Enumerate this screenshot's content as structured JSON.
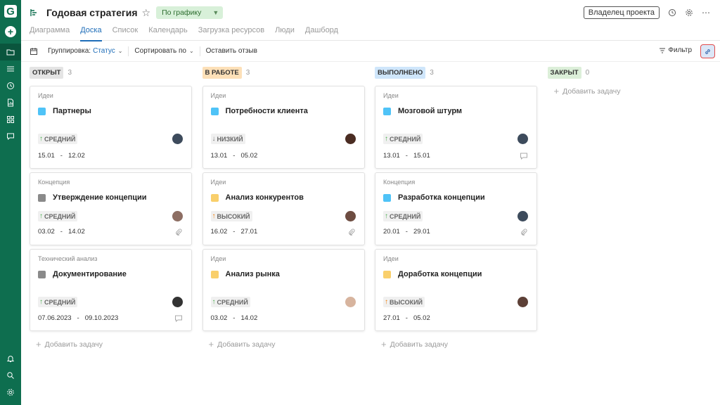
{
  "app": {
    "logo_letter": "G",
    "plus": "+"
  },
  "header": {
    "title": "Годовая стратегия",
    "status": "По графику",
    "owner_button": "Владелец проекта"
  },
  "tabs": [
    {
      "label": "Диаграмма",
      "active": false
    },
    {
      "label": "Доска",
      "active": true
    },
    {
      "label": "Список",
      "active": false
    },
    {
      "label": "Календарь",
      "active": false
    },
    {
      "label": "Загрузка ресурсов",
      "active": false
    },
    {
      "label": "Люди",
      "active": false
    },
    {
      "label": "Дашборд",
      "active": false
    }
  ],
  "toolbar": {
    "grouping_label": "Группировка:",
    "grouping_value": "Статус",
    "sort_label": "Сортировать по",
    "feedback_label": "Оставить отзыв",
    "filter_label": "Фильтр"
  },
  "board": {
    "add_task_label": "Добавить задачу",
    "columns": [
      {
        "name": "ОТКРЫТ",
        "count": "3",
        "badge_color": "#e4e4e4",
        "cards": [
          {
            "category": "Идеи",
            "title": "Партнеры",
            "color": "#4fc3f7",
            "priority": "СРЕДНИЙ",
            "priority_arrow": "↑",
            "arrow_color": "#4caf50",
            "start": "15.01",
            "end": "12.02",
            "avatar_color": "#3d4b5c",
            "icon": ""
          },
          {
            "category": "Концепция",
            "title": "Утверждение концепции",
            "color": "#8a8a8a",
            "priority": "СРЕДНИЙ",
            "priority_arrow": "↑",
            "arrow_color": "#4caf50",
            "start": "03.02",
            "end": "14.02",
            "avatar_color": "#8d6e63",
            "icon": "paperclip-icon"
          },
          {
            "category": "Технический анализ",
            "title": "Документирование",
            "color": "#8a8a8a",
            "priority": "СРЕДНИЙ",
            "priority_arrow": "↑",
            "arrow_color": "#4caf50",
            "start": "07.06.2023",
            "end": "09.10.2023",
            "avatar_color": "#333333",
            "icon": "comment-icon"
          }
        ]
      },
      {
        "name": "В РАБОТЕ",
        "count": "3",
        "badge_color": "#fde0b8",
        "cards": [
          {
            "category": "Идеи",
            "title": "Потребности клиента",
            "color": "#4fc3f7",
            "priority": "НИЗКИЙ",
            "priority_arrow": "↓",
            "arrow_color": "#777777",
            "start": "13.01",
            "end": "05.02",
            "avatar_color": "#4a2c22",
            "icon": ""
          },
          {
            "category": "Идеи",
            "title": "Анализ конкурентов",
            "color": "#f9cf6b",
            "priority": "ВЫСОКИЙ",
            "priority_arrow": "↑",
            "arrow_color": "#f57c00",
            "start": "16.02",
            "end": "27.01",
            "avatar_color": "#6d4c41",
            "icon": "paperclip-icon"
          },
          {
            "category": "Идеи",
            "title": "Анализ рынка",
            "color": "#f9cf6b",
            "priority": "СРЕДНИЙ",
            "priority_arrow": "↑",
            "arrow_color": "#4caf50",
            "start": "03.02",
            "end": "14.02",
            "avatar_color": "#d7b49e",
            "icon": ""
          }
        ]
      },
      {
        "name": "ВЫПОЛНЕНО",
        "count": "3",
        "badge_color": "#cfe6fb",
        "cards": [
          {
            "category": "Идеи",
            "title": "Мозговой штурм",
            "color": "#4fc3f7",
            "priority": "СРЕДНИЙ",
            "priority_arrow": "↑",
            "arrow_color": "#4caf50",
            "start": "13.01",
            "end": "15.01",
            "avatar_color": "#3d4b5c",
            "icon": "comment-icon"
          },
          {
            "category": "Концепция",
            "title": "Разработка концепции",
            "color": "#4fc3f7",
            "priority": "СРЕДНИЙ",
            "priority_arrow": "↑",
            "arrow_color": "#4caf50",
            "start": "20.01",
            "end": "29.01",
            "avatar_color": "#3d4b5c",
            "icon": "paperclip-icon"
          },
          {
            "category": "Идеи",
            "title": "Доработка концепции",
            "color": "#f9cf6b",
            "priority": "ВЫСОКИЙ",
            "priority_arrow": "↑",
            "arrow_color": "#f57c00",
            "start": "27.01",
            "end": "05.02",
            "avatar_color": "#5d4037",
            "icon": ""
          }
        ]
      },
      {
        "name": "ЗАКРЫТ",
        "count": "0",
        "badge_color": "#dcefd9",
        "cards": []
      }
    ]
  }
}
